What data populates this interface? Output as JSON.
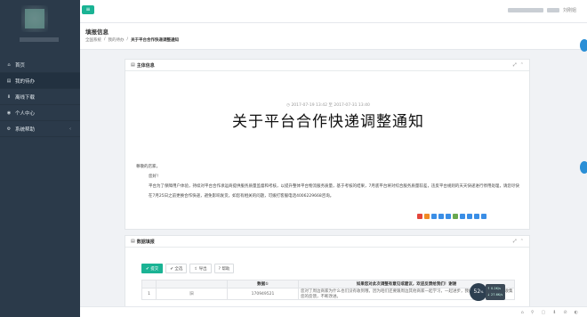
{
  "sidebar": {
    "items": [
      {
        "icon": "home-icon",
        "glyph": "⌂",
        "label": "首页"
      },
      {
        "icon": "tasks-icon",
        "glyph": "▤",
        "label": "我的待办"
      },
      {
        "icon": "download-icon",
        "glyph": "⬇",
        "label": "离线下载"
      },
      {
        "icon": "user-icon",
        "glyph": "◉",
        "label": "个人中心"
      },
      {
        "icon": "gear-icon",
        "glyph": "⚙",
        "label": "系统帮助",
        "chevron": "‹"
      }
    ]
  },
  "topbar": {
    "menu_glyph": "≡",
    "user_name": "刘刚姐"
  },
  "header": {
    "title": "填报信息",
    "breadcrumb": [
      "全国系统",
      "我的待办",
      "关于平台合作快递调整通知"
    ]
  },
  "notice": {
    "panel_title": "主体信息",
    "date": "2017-07-19 13:42 至 2017-07-31 13:40",
    "title": "关于平台合作快递调整通知",
    "greeting": "尊敬的店家，",
    "hello": "您好！",
    "body": "平台为了保障用户体验，持续对平台合作承运商提供服务质量监督和考核，以提升整体平台物流服务质量，基于考核的结果，7月底平台将对综合服务质量较差，违反平台规则的天天快递进行停用处理，请您尽快在7月25日之前更换合作快递，避免影响发货，如您有相关的问题，可拨打客服电话4006229668咨询。"
  },
  "data_panel": {
    "title": "数据填报",
    "buttons": {
      "submit": "提交",
      "select_all": "全选",
      "export": "导出",
      "help": "帮助"
    },
    "columns": [
      "",
      "",
      "数据①",
      "如果您对此次调整有意见或建议，欢迎反馈给我们！谢谢"
    ],
    "rows": [
      {
        "no": "1",
        "flag": "",
        "mark": "旧",
        "value": "17094952​1",
        "note": "您对了周边商家为什么也们没有收到哦，因为咱们还要跟周边其他商家一起学习，一起进步，我们会在以后的工作中收集您的反馈，不断改进。"
      }
    ]
  },
  "widgets": {
    "speed": "52",
    "up": "0.2K/s",
    "down": "27.6K/s"
  },
  "colors": {
    "accent": "#1ab394",
    "sidebar_bg": "#2b3a4a"
  }
}
